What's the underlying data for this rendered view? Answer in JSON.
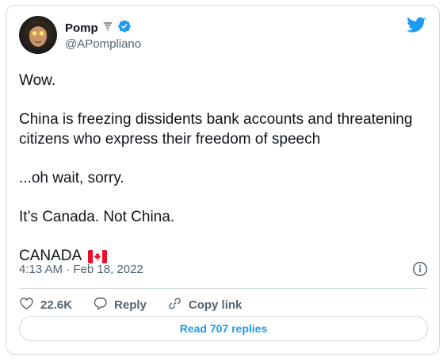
{
  "tweet": {
    "author": {
      "display_name": "Pomp",
      "handle": "@APompliano",
      "name_emoji_icon": "tornado-icon",
      "verified_icon": "verified-badge-icon"
    },
    "brand_icon": "twitter-bird-icon",
    "body": {
      "line1": "Wow.",
      "line2": "China is freezing dissidents bank accounts and threatening citizens who express their freedom of speech",
      "line3": "...oh wait, sorry.",
      "line4": "It’s Canada. Not China.",
      "line5": "CANADA",
      "line5_emoji_icon": "canada-flag-icon"
    },
    "timestamp": "4:13 AM · Feb 18, 2022",
    "info_icon": "info-icon",
    "actions": {
      "likes_count": "22.6K",
      "reply_label": "Reply",
      "copy_link_label": "Copy link"
    },
    "read_replies_label": "Read 707 replies"
  },
  "colors": {
    "accent": "#1d9bf0",
    "like_hover": "#f91880",
    "text_primary": "#0f1419",
    "text_secondary": "#536471",
    "border": "#cfd9de"
  }
}
